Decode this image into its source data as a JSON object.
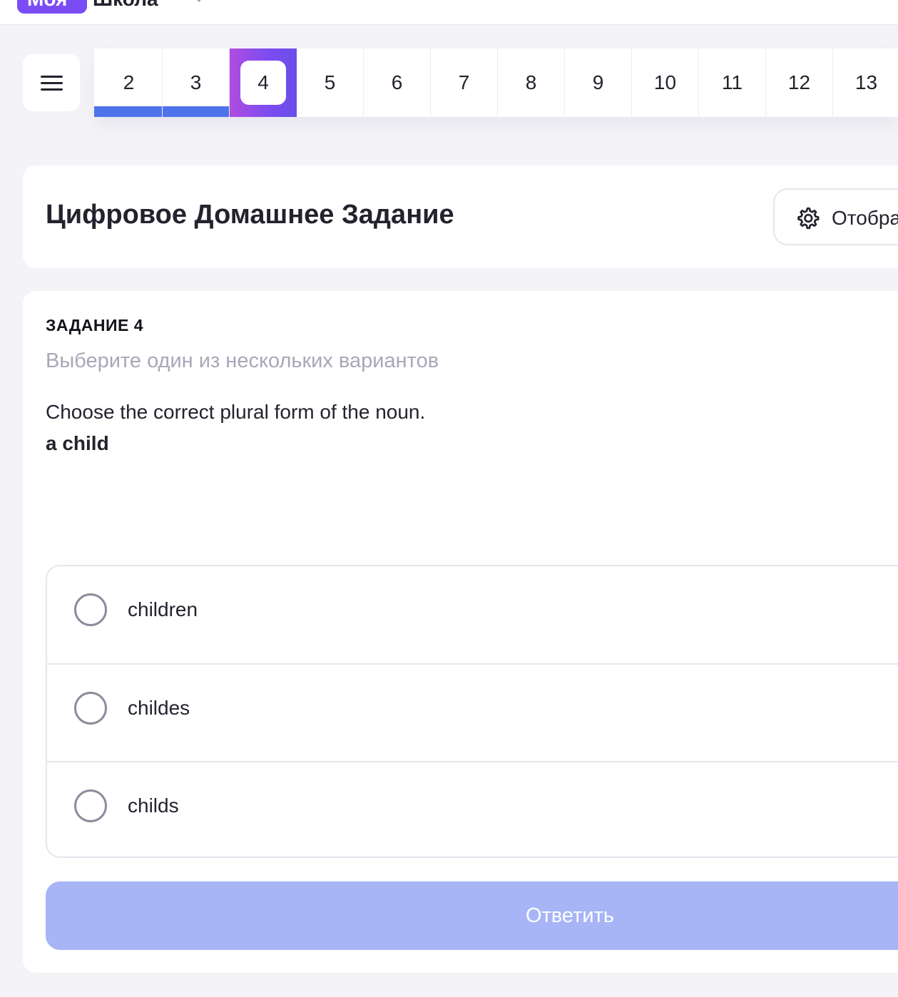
{
  "header": {
    "logo_badge": "Моя",
    "logo_text": "Школа"
  },
  "nav": {
    "items": [
      "2",
      "3",
      "4",
      "5",
      "6",
      "7",
      "8",
      "9",
      "10",
      "11",
      "12",
      "13"
    ],
    "done": [
      "2",
      "3"
    ],
    "active": "4",
    "colors": {
      "done_bar": "#4f73ea",
      "active_gradient": [
        "#b04ce0",
        "#6a4ee8"
      ]
    }
  },
  "page": {
    "title": "Цифровое Домашнее Задание",
    "settings_label": "Отобра"
  },
  "task": {
    "label": "ЗАДАНИЕ 4",
    "instruction": "Выберите один из нескольких вариантов",
    "question": "Choose the correct plural form of the noun.",
    "word": "a child",
    "options": [
      "children",
      "childes",
      "childs"
    ],
    "submit_label": "Ответить"
  },
  "icons": {
    "menu": "menu-icon",
    "settings": "gear-icon",
    "logo_dropdown": "chevron-down-icon"
  }
}
